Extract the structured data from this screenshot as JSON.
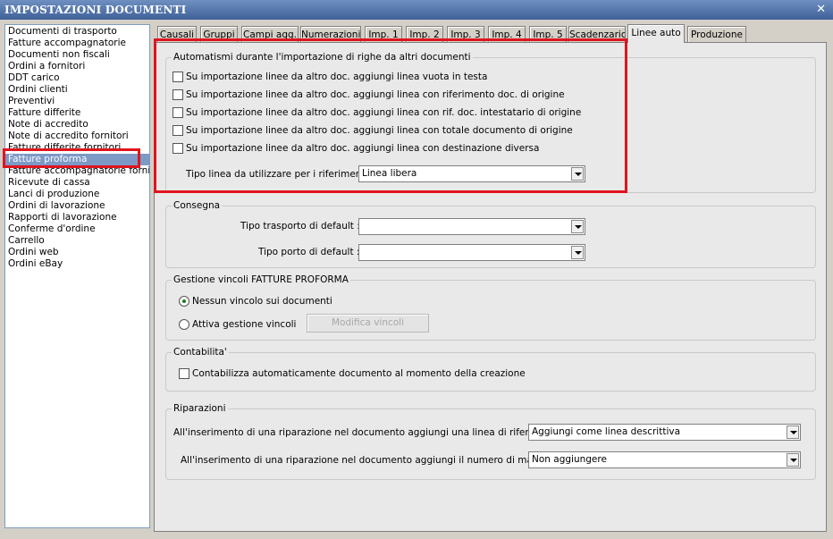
{
  "window": {
    "title": "IMPOSTAZIONI DOCUMENTI",
    "close_glyph": "✕"
  },
  "doc_list": [
    "Documenti di trasporto",
    "Fatture accompagnatorie",
    "Documenti non fiscali",
    "Ordini a fornitori",
    "DDT carico",
    "Ordini clienti",
    "Preventivi",
    "Fatture differite",
    "Note di accredito",
    "Note di accredito fornitori",
    "Fatture differite fornitori",
    "Fatture proforma",
    "Fatture accompagnatorie fornitori",
    "Ricevute di cassa",
    "Lanci di produzione",
    "Ordini di lavorazione",
    "Rapporti di lavorazione",
    "Conferme d'ordine",
    "Carrello",
    "Ordini web",
    "Ordini eBay"
  ],
  "selected_doc": "Fatture proforma",
  "tabs": [
    "Causali",
    "Gruppi",
    "Campi agg.",
    "Numerazioni",
    "Imp. 1",
    "Imp. 2",
    "Imp. 3",
    "Imp. 4",
    "Imp. 5",
    "Scadenzario",
    "Linee auto",
    "Produzione"
  ],
  "active_tab": "Linee auto",
  "automatismi": {
    "title": "Automatismi durante l'importazione di righe da altri documenti",
    "checks": [
      "Su importazione linee da altro doc. aggiungi linea vuota in testa",
      "Su importazione linee da altro doc. aggiungi linea con riferimento doc. di origine",
      "Su importazione linee da altro doc. aggiungi linea con rif. doc. intestatario di origine",
      "Su importazione linee da altro doc. aggiungi linea con totale documento di origine",
      "Su importazione linee da altro doc. aggiungi linea con destinazione diversa"
    ],
    "tipo_linea_label": "Tipo linea da utilizzare per i riferimenti :",
    "tipo_linea_value": "Linea libera"
  },
  "consegna": {
    "title": "Consegna",
    "trasporto_label": "Tipo trasporto di default :",
    "trasporto_value": "",
    "porto_label": "Tipo porto di default :",
    "porto_value": ""
  },
  "vincoli": {
    "title": "Gestione vincoli FATTURE PROFORMA",
    "option_none": "Nessun vincolo sui documenti",
    "option_active": "Attiva gestione vincoli",
    "modify_button": "Modifica vincoli"
  },
  "contabilita": {
    "title": "Contabilita'",
    "check_label": "Contabilizza automaticamente documento al momento della creazione"
  },
  "riparazioni": {
    "title": "Riparazioni",
    "riferimento_label": "All'inserimento di una riparazione nel documento aggiungi una linea di riferimento :",
    "riferimento_value": "Aggiungi come linea descrittiva",
    "matricola_label": "All'inserimento di una riparazione nel documento aggiungi il numero di matricola :",
    "matricola_value": "Non aggiungere"
  },
  "colors": {
    "highlight_red": "#e0141e",
    "selection_blue": "#7d99c6",
    "titlebar": "#3f6198"
  }
}
